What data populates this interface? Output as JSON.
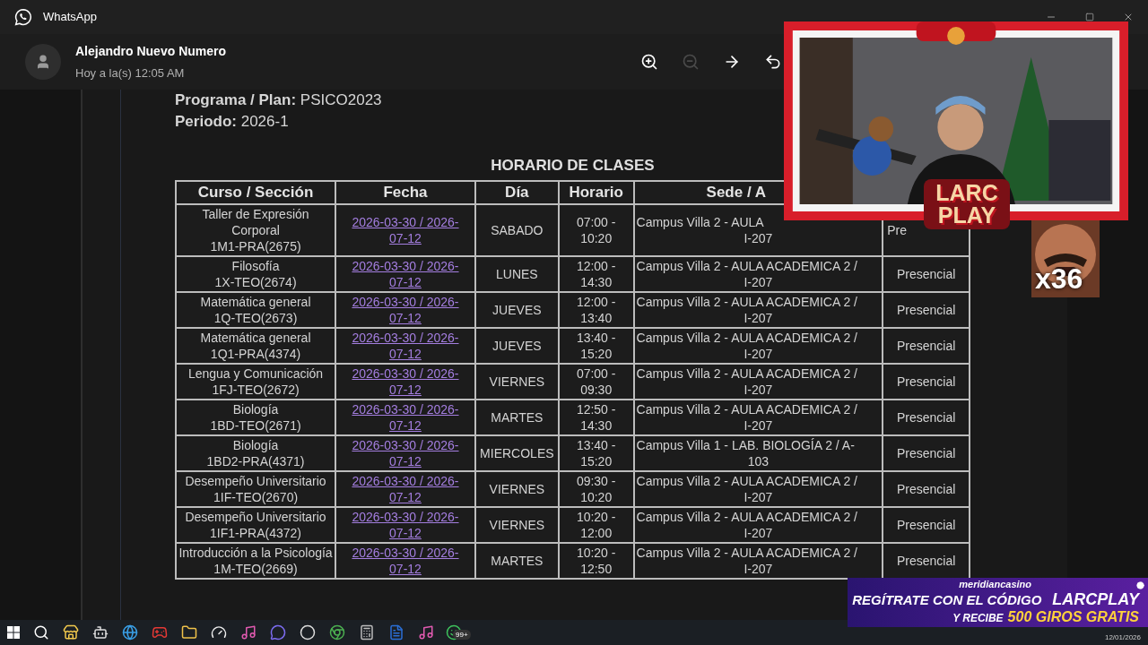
{
  "app": {
    "title": "WhatsApp"
  },
  "chat": {
    "contact": "Alejandro Nuevo Numero",
    "timestamp": "Hoy a la(s) 12:05 AM"
  },
  "viewer_toolbar": [
    {
      "kind": "zoom-in",
      "disabled": false
    },
    {
      "kind": "zoom-out",
      "disabled": true
    },
    {
      "kind": "forward",
      "disabled": false
    },
    {
      "kind": "reply",
      "disabled": false
    }
  ],
  "document": {
    "info": [
      {
        "label": "Programa / Plan:",
        "value": "PSICO2023"
      },
      {
        "label": "Periodo:",
        "value": "2026-1"
      }
    ],
    "table_title": "HORARIO DE CLASES",
    "columns": [
      "Curso / Sección",
      "Fecha",
      "Día",
      "Horario",
      "Sede / A"
    ],
    "rows": [
      {
        "course": "Taller de Expresión Corporal",
        "section": "1M1-PRA(2675)",
        "date": "2026-03-30 / 2026-07-12",
        "day": "SABADO",
        "time": "07:00 - 10:20",
        "site": [
          "Campus Villa 2 - AULA",
          "I-207"
        ],
        "mode": "Pre"
      },
      {
        "course": "Filosofía",
        "section": "1X-TEO(2674)",
        "date": "2026-03-30 / 2026-07-12",
        "day": "LUNES",
        "time": "12:00 - 14:30",
        "site": [
          "Campus Villa 2 - AULA ACADEMICA 2 /",
          "I-207"
        ],
        "mode": "Presencial"
      },
      {
        "course": "Matemática general",
        "section": "1Q-TEO(2673)",
        "date": "2026-03-30 / 2026-07-12",
        "day": "JUEVES",
        "time": "12:00 - 13:40",
        "site": [
          "Campus Villa 2 - AULA ACADEMICA 2 /",
          "I-207"
        ],
        "mode": "Presencial"
      },
      {
        "course": "Matemática general",
        "section": "1Q1-PRA(4374)",
        "date": "2026-03-30 / 2026-07-12",
        "day": "JUEVES",
        "time": "13:40 - 15:20",
        "site": [
          "Campus Villa 2 - AULA ACADEMICA 2 /",
          "I-207"
        ],
        "mode": "Presencial"
      },
      {
        "course": "Lengua y Comunicación",
        "section": "1FJ-TEO(2672)",
        "date": "2026-03-30 / 2026-07-12",
        "day": "VIERNES",
        "time": "07:00 - 09:30",
        "site": [
          "Campus Villa 2 - AULA ACADEMICA 2 /",
          "I-207"
        ],
        "mode": "Presencial"
      },
      {
        "course": "Biología",
        "section": "1BD-TEO(2671)",
        "date": "2026-03-30 / 2026-07-12",
        "day": "MARTES",
        "time": "12:50 - 14:30",
        "site": [
          "Campus Villa 2 - AULA ACADEMICA 2 /",
          "I-207"
        ],
        "mode": "Presencial"
      },
      {
        "course": "Biología",
        "section": "1BD2-PRA(4371)",
        "date": "2026-03-30 / 2026-07-12",
        "day": "MIERCOLES",
        "time": "13:40 - 15:20",
        "site": [
          "Campus Villa 1 - LAB. BIOLOGÍA 2 / A-",
          "103"
        ],
        "mode": "Presencial"
      },
      {
        "course": "Desempeño Universitario",
        "section": "1IF-TEO(2670)",
        "date": "2026-03-30 / 2026-07-12",
        "day": "VIERNES",
        "time": "09:30 - 10:20",
        "site": [
          "Campus Villa 2 - AULA ACADEMICA 2 /",
          "I-207"
        ],
        "mode": "Presencial"
      },
      {
        "course": "Desempeño Universitario",
        "section": "1IF1-PRA(4372)",
        "date": "2026-03-30 / 2026-07-12",
        "day": "VIERNES",
        "time": "10:20 - 12:00",
        "site": [
          "Campus Villa 2 - AULA ACADEMICA 2 /",
          "I-207"
        ],
        "mode": "Presencial"
      },
      {
        "course": "Introducción a la Psicología",
        "section": "1M-TEO(2669)",
        "date": "2026-03-30 / 2026-07-12",
        "day": "MARTES",
        "time": "10:20 - 12:50",
        "site": [
          "Campus Villa 2 - AULA ACADEMICA 2 /",
          "I-207"
        ],
        "mode": "Presencial"
      }
    ]
  },
  "stream_overlay": {
    "logo": "LARC PLAY",
    "counter": "x36"
  },
  "ad_banner": {
    "brand": "meridiancasino",
    "line_1": "REGÍTRATE CON EL CÓDIGO",
    "code": "LARCPLAY",
    "line_2": "Y RECIBE",
    "offer": "500 GIROS GRATIS"
  },
  "taskbar": {
    "badge": "99+",
    "date": "12/01/2026"
  }
}
